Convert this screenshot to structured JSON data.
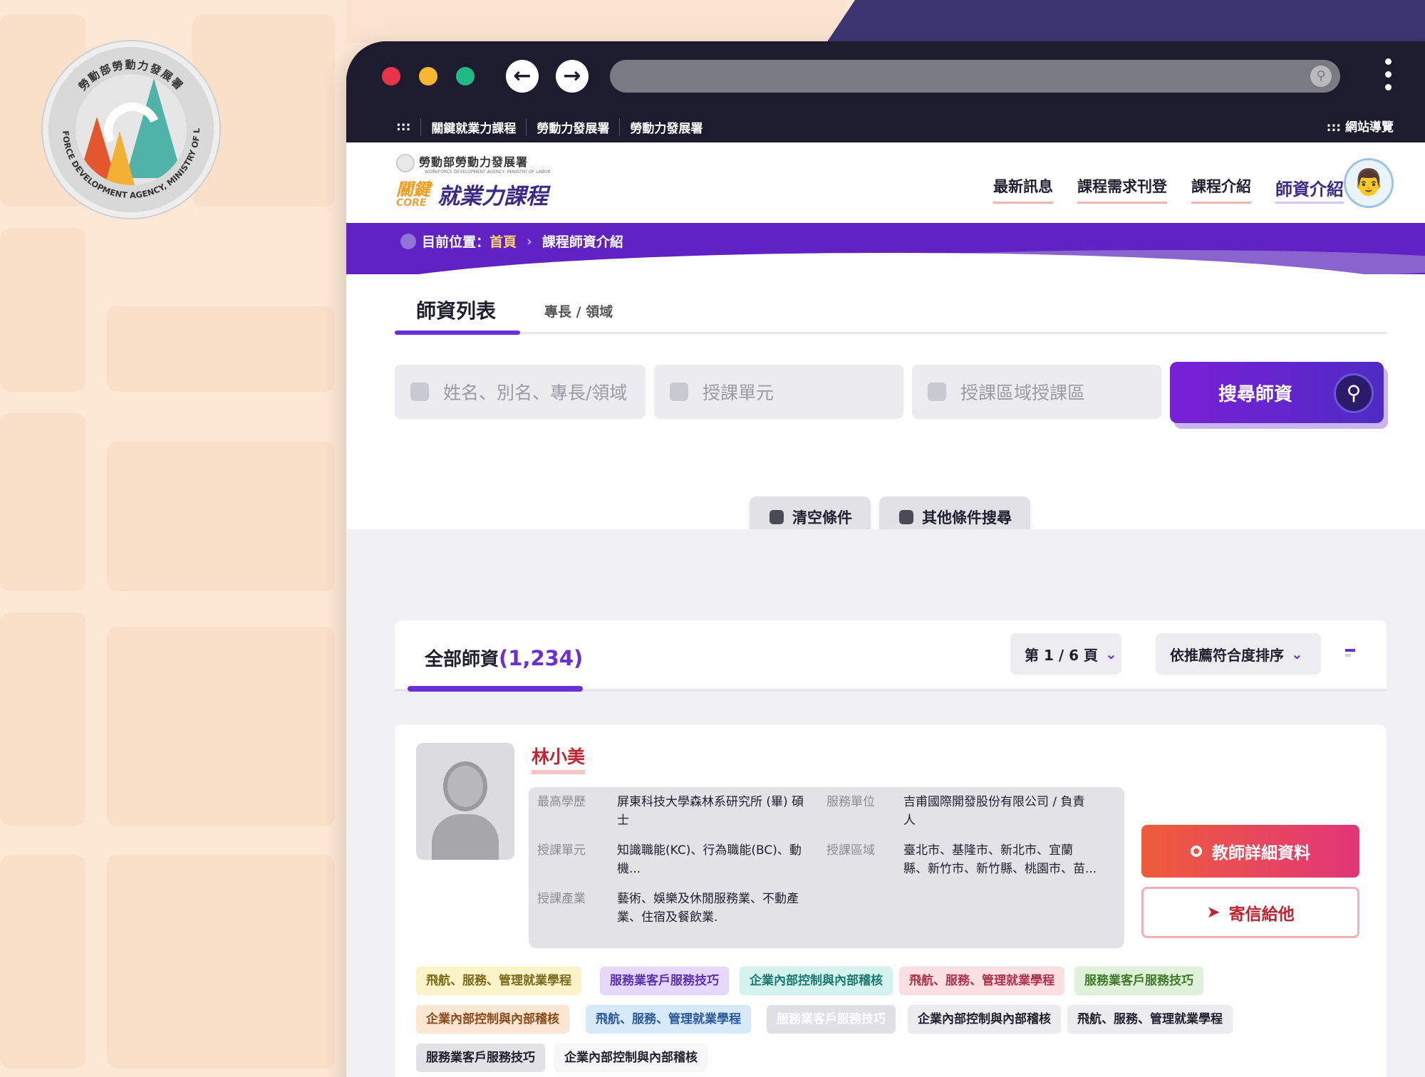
{
  "seal": {
    "top_text": "勞動部勞動力發展署",
    "bottom_text": "WORKFORCE DEVELOPMENT AGENCY, MINISTRY OF LABOR"
  },
  "browser": {
    "nav_back_icon": "arrow-left-icon",
    "nav_forward_icon": "arrow-right-icon"
  },
  "quicklinks": {
    "prefix": ":::",
    "items": [
      "關鍵就業力課程",
      "勞動力發展署",
      "勞動力發展署"
    ],
    "sitemap": "::: 網站導覽"
  },
  "header": {
    "agency_name": "勞動部勞動力發展署",
    "agency_en": "WORKFORCE DEVELOPMENT AGENCY, MINISTRY OF LABOR",
    "core_cn": "關鍵",
    "core_en": "CORE",
    "site_title": "就業力課程",
    "nav": [
      "最新訊息",
      "課程需求刊登",
      "課程介紹",
      "師資介紹"
    ]
  },
  "breadcrumb": {
    "label": "目前位置：",
    "home": "首頁",
    "current": "課程師資介紹"
  },
  "tabs": [
    "師資列表",
    "專長 / 領域"
  ],
  "search": {
    "name_placeholder": "姓名、別名、專長/領域",
    "unit_placeholder": "授課單元",
    "area_placeholder": "授課區域授課區",
    "submit": "搜尋師資",
    "clear": "清空條件",
    "more": "其他條件搜尋"
  },
  "results": {
    "all_label": "全部師資",
    "count": "(1,234)",
    "page": "第 1 / 6 頁",
    "sort": "依推薦符合度排序"
  },
  "teacher": {
    "name": "林小美",
    "fields": {
      "edu_label": "最高學歷",
      "edu_line1": "屏東科技大學森林系研究所 (畢) 碩",
      "edu_line2": "士",
      "org_label": "服務單位",
      "org_line1": "吉甫國際開發股份有限公司 / 負責",
      "org_line2": "人",
      "unit_label": "授課單元",
      "unit_line1": "知識職能(KC)、行為職能(BC)、動",
      "unit_line2": "機...",
      "area_label": "授課區域",
      "area_line1": "臺北市、基隆市、新北市、宜蘭",
      "area_line2": "縣、新竹市、新竹縣、桃園市、苗...",
      "industry_label": "授課產業",
      "industry_line1": "藝術、娛樂及休閒服務業、不動產",
      "industry_line2": "業、住宿及餐飲業."
    },
    "detail_button": "教師詳細資料",
    "mail_button": "寄信給他",
    "tags": [
      "飛航、服務、管理就業學程",
      "服務業客戶服務技巧",
      "企業內部控制與內部稽核",
      "飛航、服務、管理就業學程",
      "服務業客戶服務技巧",
      "企業內部控制與內部稽核",
      "飛航、服務、管理就業學程",
      "服務業客戶服務技巧",
      "企業內部控制與內部稽核",
      "飛航、服務、管理就業學程",
      "服務業客戶服務技巧",
      "企業內部控制與內部稽核"
    ]
  },
  "colors": {
    "primary": "#6a30d8",
    "accent_red": "#c02433",
    "bg_peach": "#fde8d6",
    "chrome": "#1d1c2e"
  }
}
